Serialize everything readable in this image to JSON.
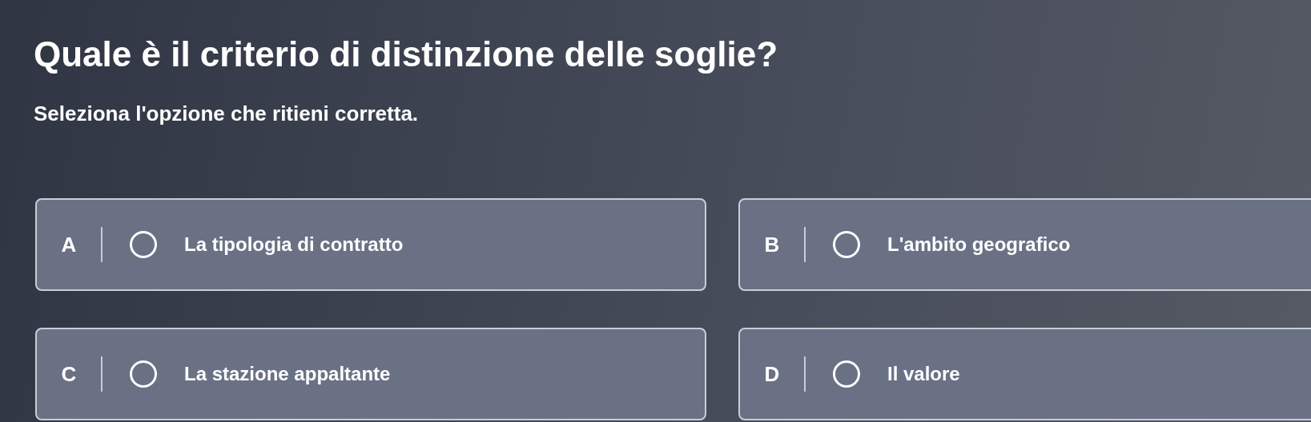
{
  "question": {
    "title": "Quale è il criterio di distinzione delle soglie?",
    "instruction": "Seleziona l'opzione che ritieni corretta."
  },
  "options": [
    {
      "letter": "A",
      "label": "La tipologia di contratto",
      "selected": false
    },
    {
      "letter": "B",
      "label": "L'ambito geografico",
      "selected": false
    },
    {
      "letter": "C",
      "label": "La stazione appaltante",
      "selected": false
    },
    {
      "letter": "D",
      "label": "Il valore",
      "selected": false
    }
  ]
}
